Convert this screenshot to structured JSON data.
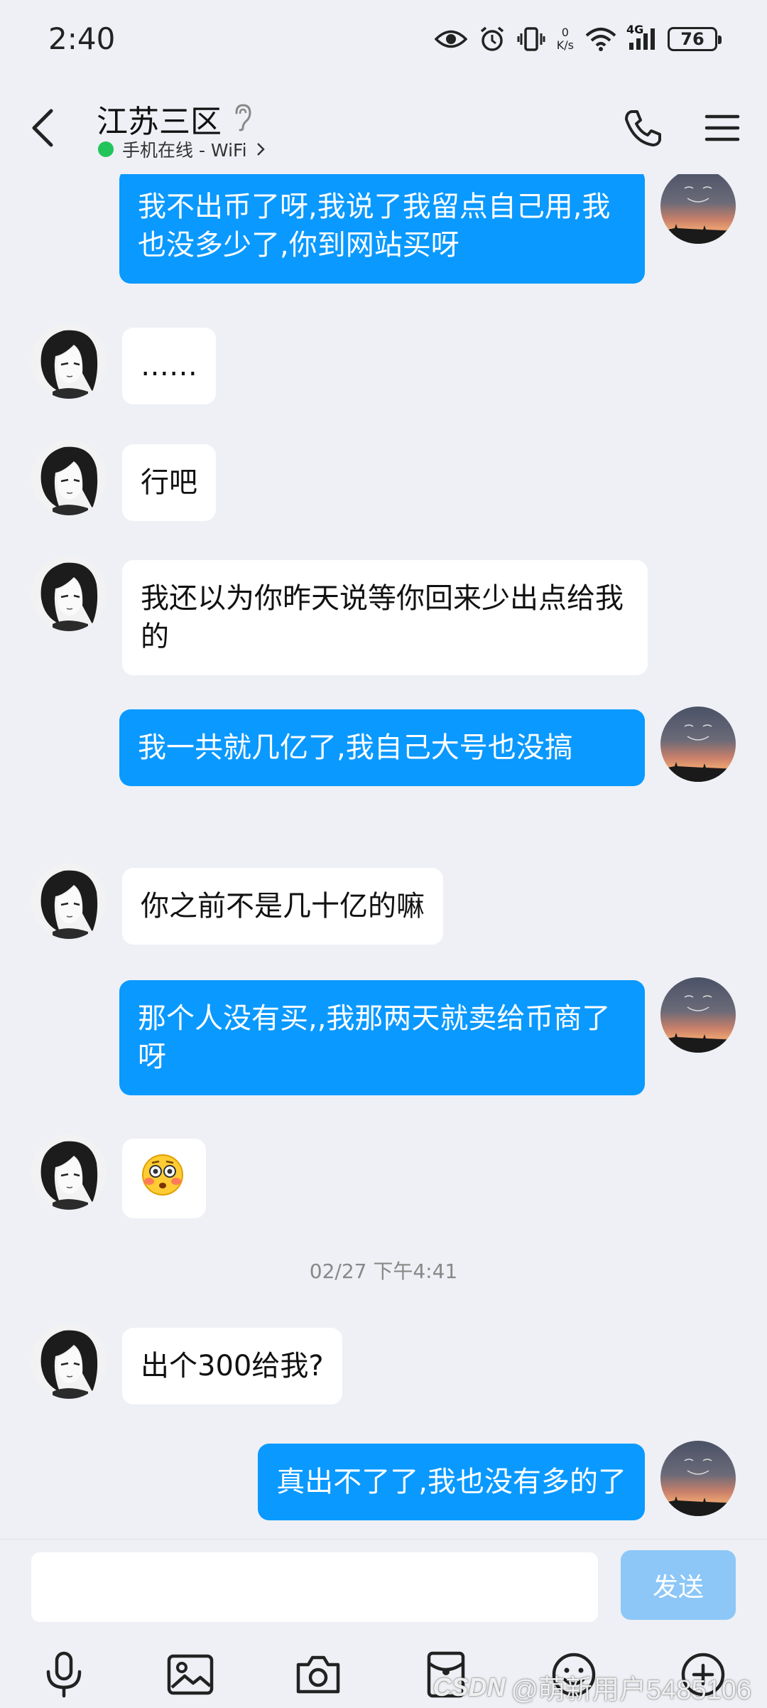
{
  "status_bar": {
    "time": "2:40",
    "net_speed_value": "0",
    "net_speed_unit": "K/s",
    "network_type": "4G",
    "battery_level": "76"
  },
  "header": {
    "title": "江苏三区",
    "subtitle": "手机在线 - WiFi",
    "online_color": "#21c45a"
  },
  "messages": [
    {
      "side": "out",
      "text": "我不出币了呀,我说了我留点自己用,我也没多少了,你到网站买呀"
    },
    {
      "side": "in",
      "text": "……"
    },
    {
      "side": "in",
      "text": "行吧"
    },
    {
      "side": "in",
      "text": "我还以为你昨天说等你回来少出点给我的"
    },
    {
      "side": "out",
      "text": "我一共就几亿了,我自己大号也没搞"
    },
    {
      "side": "in",
      "text": "你之前不是几十亿的嘛"
    },
    {
      "side": "out",
      "text": "那个人没有买,,我那两天就卖给币商了呀"
    },
    {
      "side": "in",
      "emoji": "😳"
    },
    {
      "timestamp": "02/27 下午4:41"
    },
    {
      "side": "in",
      "text": "出个300给我?"
    },
    {
      "side": "out",
      "text": "真出不了了,我也没有多的了"
    }
  ],
  "input_bar": {
    "placeholder": "",
    "send_label": "发送"
  },
  "toolbar": {
    "items": [
      "microphone-icon",
      "image-icon",
      "camera-icon",
      "red-packet-icon",
      "emoji-icon",
      "plus-icon"
    ]
  },
  "watermark": {
    "logo": "CSDN",
    "text": "@萌新用户5485106"
  },
  "colors": {
    "outgoing_bubble": "#0a99ff",
    "incoming_bubble": "#ffffff",
    "background": "#eef0f5",
    "send_button": "#8cc7f7"
  }
}
